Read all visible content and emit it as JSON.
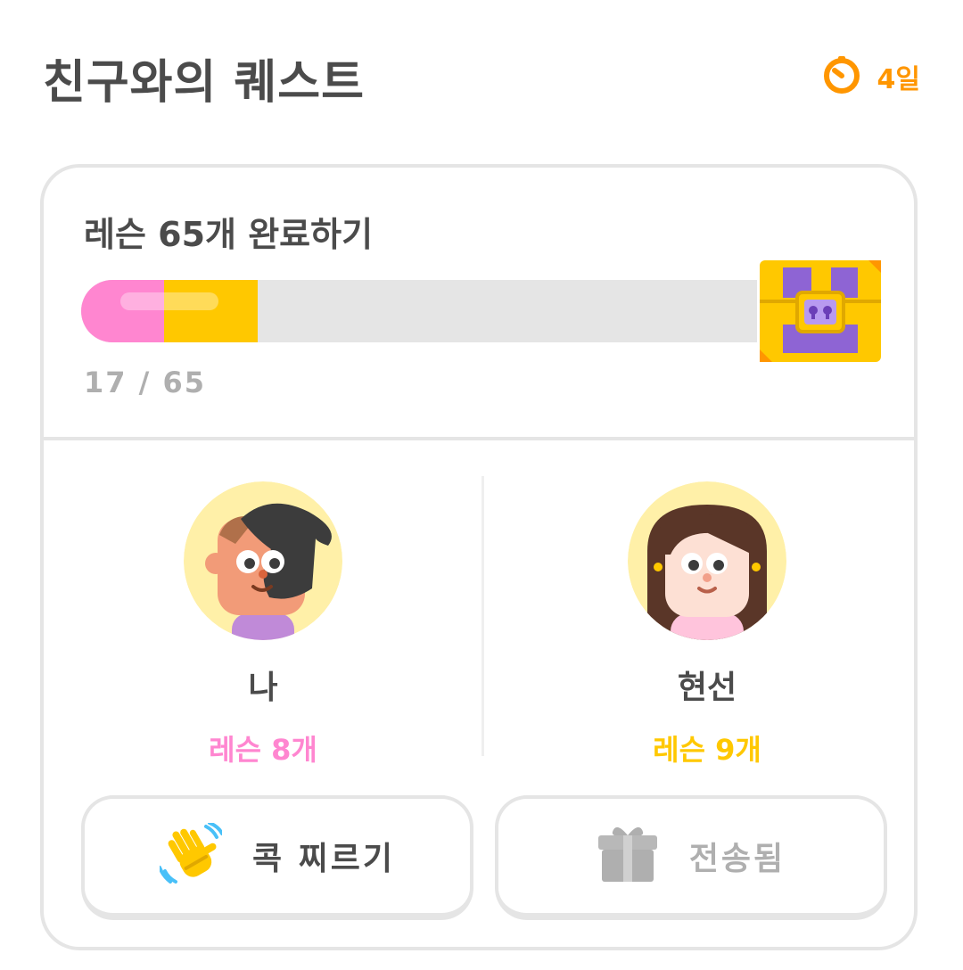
{
  "header": {
    "title": "친구와의 퀘스트",
    "time_left": "4일",
    "timer_icon": "timer-icon",
    "accent_color": "#ff9600"
  },
  "quest": {
    "goal": "레슨 65개 완료하기",
    "progress_text": "17 / 65",
    "total": 65,
    "my_fraction": 0.123,
    "friend_fraction": 0.138,
    "reward_icon": "treasure-chest-icon",
    "colors": {
      "me": "#ff86d0",
      "friend": "#ffc800",
      "track": "#e5e5e5"
    }
  },
  "friends": [
    {
      "name": "나",
      "lessons": "레슨 8개",
      "avatar": "male-avatar"
    },
    {
      "name": "현선",
      "lessons": "레슨 9개",
      "avatar": "female-avatar"
    }
  ],
  "actions": {
    "nudge_label": "콕 찌르기",
    "nudge_icon": "waving-hand-icon",
    "sent_label": "전송됨",
    "sent_icon": "gift-icon"
  }
}
